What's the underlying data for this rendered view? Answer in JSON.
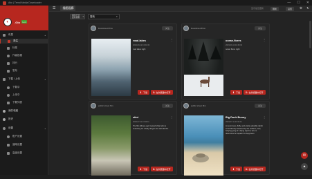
{
  "window": {
    "title": "Abc | Trend Media Downloader",
    "controls": [
      "—",
      "☐",
      "✕"
    ]
  },
  "user": {
    "name": "_Glo",
    "level": "Lv.1"
  },
  "sidebar": {
    "sections": [
      {
        "label": "讯息",
        "items": [
          {
            "label": "关注",
            "active": true
          },
          {
            "label": "标签"
          },
          {
            "label": "作者投稿"
          },
          {
            "label": "排行"
          },
          {
            "label": "发布"
          }
        ]
      },
      {
        "label": "下载 / 上传",
        "items": [
          {
            "label": "下载中"
          },
          {
            "label": "上传中"
          },
          {
            "label": "下载列表"
          }
        ]
      },
      {
        "label": "我的收藏",
        "items": []
      },
      {
        "label": "历史",
        "items": []
      },
      {
        "label": "设置",
        "items": [
          {
            "label": "账户设置"
          },
          {
            "label": "通用设置"
          },
          {
            "label": "高级设置"
          }
        ]
      }
    ]
  },
  "header": {
    "app_title": "插图画廊",
    "info": "显示最近更新",
    "actions": [
      "刷新",
      "设置"
    ]
  },
  "filter": {
    "sort_label": "排序方式\n最新投稿",
    "search_value": "搜索"
  },
  "posts": [
    {
      "author": "ilovestreet-films",
      "follow_label": "关注",
      "title": "road-lakes",
      "date": "2023-09-12 13:04:33",
      "tags": "road lakes night",
      "download_label": "下载",
      "open_label": "在浏览器中打开"
    },
    {
      "author": "ilovestreet-films",
      "follow_label": "关注",
      "title": "ocean-flores",
      "date": "2023-09-12 10:46:02",
      "tags": "ocean flores night",
      "download_label": "下载",
      "open_label": "在浏览器中打开"
    },
    {
      "author": "public street film",
      "follow_label": "关注",
      "title": "stint",
      "date": "2023-07-11 13:34:11",
      "tags": "The film follows a girl named Violet who is searching for a baby dragon she calls Emilio.",
      "download_label": "下载",
      "open_label": "在浏览器中打开"
    },
    {
      "author": "public street film",
      "follow_label": "关注",
      "title": "Big Duck Bunny",
      "date": "2023-07-11 13:34:11",
      "tags": "An enormous, fluffy, and utterly adorable rabbit is heartlessly harassed by the ruthless, loud, bullying gang of a flying squirrel, who is determined to squash his happiness.",
      "download_label": "下载",
      "open_label": "在浏览器中打开"
    }
  ],
  "colors": {
    "accent": "#b7271f",
    "background": "#232323",
    "sidebar": "#1b1b1b"
  }
}
